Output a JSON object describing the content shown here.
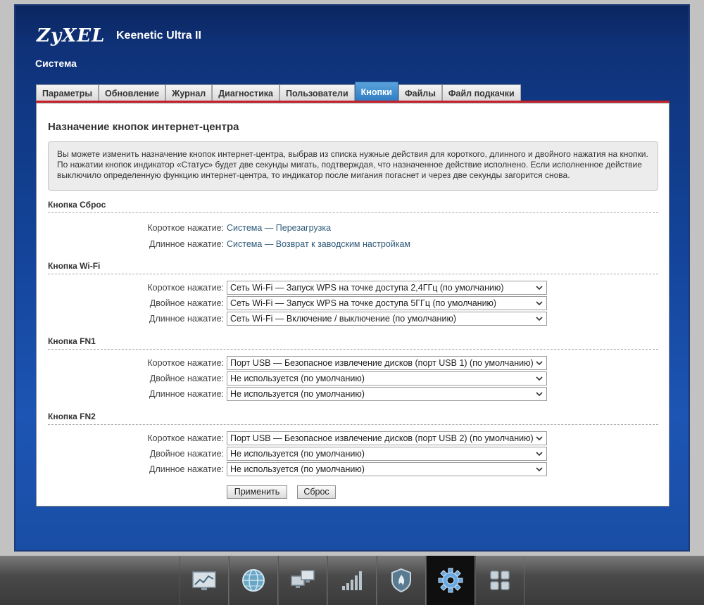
{
  "header": {
    "brand": "ZyXEL",
    "model": "Keenetic Ultra II",
    "section": "Система"
  },
  "tabs": [
    {
      "label": "Параметры",
      "active": false
    },
    {
      "label": "Обновление",
      "active": false
    },
    {
      "label": "Журнал",
      "active": false
    },
    {
      "label": "Диагностика",
      "active": false
    },
    {
      "label": "Пользователи",
      "active": false
    },
    {
      "label": "Кнопки",
      "active": true
    },
    {
      "label": "Файлы",
      "active": false
    },
    {
      "label": "Файл подкачки",
      "active": false
    }
  ],
  "page": {
    "title": "Назначение кнопок интернет-центра",
    "info": "Вы можете изменить назначение кнопок интернет-центра, выбрав из списка нужные действия для короткого, длинного и двойного нажатия на кнопки. По нажатии кнопок индикатор «Статус» будет две секунды мигать, подтверждая, что назначенное действие исполнено. Если исполненное действие выключило определенную функцию интернет-центра, то индикатор после мигания погаснет и через две секунды загорится снова."
  },
  "groups": {
    "reset": {
      "title": "Кнопка Сброс",
      "short_label": "Короткое нажатие:",
      "short_value": "Система — Перезагрузка",
      "long_label": "Длинное нажатие:",
      "long_value": "Система — Возврат к заводским настройкам"
    },
    "wifi": {
      "title": "Кнопка Wi-Fi",
      "short_label": "Короткое нажатие:",
      "short_value": "Сеть Wi-Fi — Запуск WPS на точке доступа 2,4ГГц (по умолчанию)",
      "double_label": "Двойное нажатие:",
      "double_value": "Сеть Wi-Fi — Запуск WPS на точке доступа 5ГГц (по умолчанию)",
      "long_label": "Длинное нажатие:",
      "long_value": "Сеть Wi-Fi — Включение / выключение (по умолчанию)"
    },
    "fn1": {
      "title": "Кнопка FN1",
      "short_label": "Короткое нажатие:",
      "short_value": "Порт USB — Безопасное извлечение дисков (порт USB 1) (по умолчанию)",
      "double_label": "Двойное нажатие:",
      "double_value": "Не используется (по умолчанию)",
      "long_label": "Длинное нажатие:",
      "long_value": "Не используется (по умолчанию)"
    },
    "fn2": {
      "title": "Кнопка FN2",
      "short_label": "Короткое нажатие:",
      "short_value": "Порт USB — Безопасное извлечение дисков (порт USB 2) (по умолчанию)",
      "double_label": "Двойное нажатие:",
      "double_value": "Не используется (по умолчанию)",
      "long_label": "Длинное нажатие:",
      "long_value": "Не используется (по умолчанию)"
    }
  },
  "buttons": {
    "apply": "Применить",
    "reset": "Сброс"
  },
  "dock": [
    {
      "icon": "chart-monitor-icon",
      "active": false
    },
    {
      "icon": "globe-icon",
      "active": false
    },
    {
      "icon": "network-computers-icon",
      "active": false
    },
    {
      "icon": "signal-bars-icon",
      "active": false
    },
    {
      "icon": "shield-icon",
      "active": false
    },
    {
      "icon": "gear-icon",
      "active": true
    },
    {
      "icon": "apps-grid-icon",
      "active": false
    }
  ],
  "colors": {
    "accent": "#c8202a",
    "active_tab": "#2f7cc2",
    "link_value": "#2d5a78"
  }
}
